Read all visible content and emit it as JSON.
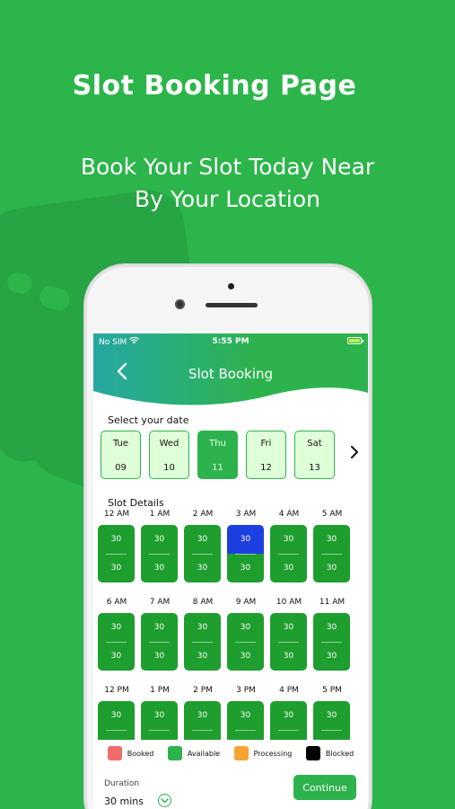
{
  "hero": {
    "title": "Slot Booking Page",
    "subtitle_line1": "Book Your Slot Today Near",
    "subtitle_line2": "By Your Location"
  },
  "status_bar": {
    "carrier": "No SIM",
    "time": "5:55 PM"
  },
  "header": {
    "title": "Slot Booking",
    "back_icon": "chevron-left-icon"
  },
  "date_section": {
    "label": "Select your date",
    "dates": [
      {
        "day": "Tue",
        "date": "09",
        "selected": false
      },
      {
        "day": "Wed",
        "date": "10",
        "selected": false
      },
      {
        "day": "Thu",
        "date": "11",
        "selected": true
      },
      {
        "day": "Fri",
        "date": "12",
        "selected": false
      },
      {
        "day": "Sat",
        "date": "13",
        "selected": false
      }
    ],
    "next_icon": "chevron-right-icon"
  },
  "slot_section": {
    "label": "Slot Details",
    "rows": [
      {
        "hours": [
          "12 AM",
          "1 AM",
          "2 AM",
          "3 AM",
          "4 AM",
          "5 AM"
        ]
      },
      {
        "hours": [
          "6 AM",
          "7 AM",
          "8 AM",
          "9 AM",
          "10 AM",
          "11 AM"
        ]
      },
      {
        "hours": [
          "12 PM",
          "1 PM",
          "2 PM",
          "3 PM",
          "4 PM",
          "5 PM"
        ]
      }
    ],
    "half_label": "30",
    "highlighted": {
      "row": 0,
      "col": 3,
      "half": "top"
    }
  },
  "legend": [
    {
      "label": "Booked",
      "color": "#f26b6b"
    },
    {
      "label": "Available",
      "color": "#2db34d"
    },
    {
      "label": "Processing",
      "color": "#f7a531"
    },
    {
      "label": "Blocked",
      "color": "#000000"
    }
  ],
  "footer": {
    "duration_label": "Duration",
    "duration_value": "30 mins",
    "continue_label": "Continue"
  },
  "colors": {
    "brand": "#2cb54a",
    "slot_available": "#1e9e2e",
    "slot_selected": "#1e3fe0"
  }
}
